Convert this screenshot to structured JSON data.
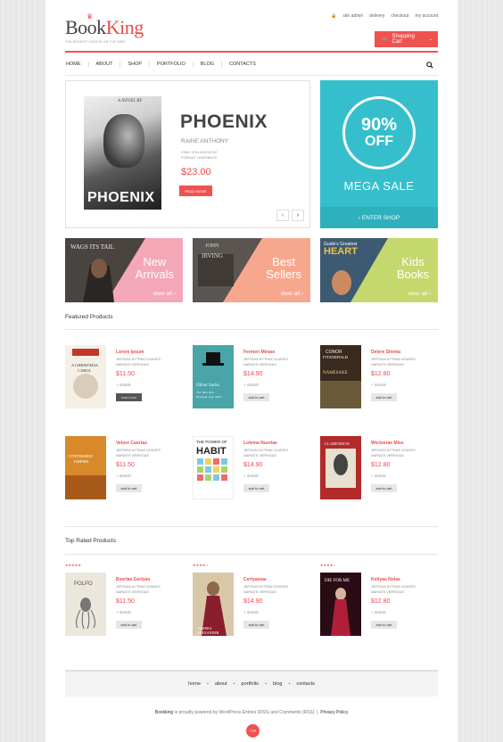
{
  "header": {
    "logo_part1": "Book",
    "logo_part2": "King",
    "tagline": "THE BIGGEST CHOICE ON THE WEB",
    "top_links": [
      "site admin",
      "delivery",
      "checkout",
      "my account"
    ],
    "cart_label": "Shopping Cart",
    "nav": [
      "HOME",
      "ABOUT",
      "SHOP",
      "PORTFOLIO",
      "BLOG",
      "CONTACTS"
    ]
  },
  "hero": {
    "cover_top": "A NOVEL BY",
    "cover_title": "PHOENIX",
    "title": "PHOENIX",
    "author": "RAINE ANTHONY",
    "isbn": "ISBN: 9781409916780",
    "format": "FORMAT: HARDBACK",
    "price": "$23.00",
    "button": "READ MORE",
    "prev": "‹",
    "next": "›"
  },
  "mega_sale": {
    "percent": "90%",
    "off": "OFF",
    "label": "MEGA SALE",
    "enter": "ENTER SHOP"
  },
  "banners": [
    {
      "line1": "New",
      "line2": "Arrivals",
      "view": "view all",
      "color": "#f4a7b7"
    },
    {
      "line1": "Best",
      "line2": "Sellers",
      "view": "view all",
      "color": "#f8a78f"
    },
    {
      "line1": "Kids",
      "line2": "Books",
      "view": "view all",
      "color": "#c5d86d"
    }
  ],
  "featured": {
    "title": "Featured Products",
    "items": [
      {
        "name": "Lorem Ipsum",
        "desc": "JERTASA NYTRAE DOASES NARIATS VERRIGAS",
        "price": "$11.50",
        "details": "+ details",
        "cart": "read more"
      },
      {
        "name": "Fermen Mirase",
        "desc": "JERTASA NYTRAE DOASES NARIATS VERRIGAS",
        "price": "$14.90",
        "details": "+ details",
        "cart": "add to cart"
      },
      {
        "name": "Delere Sitema",
        "desc": "JERTASA NYTRAE DOASES NARIATS VERRIGAS",
        "price": "$12.80",
        "details": "+ details",
        "cart": "add to cart"
      },
      {
        "name": "Velore Caortas",
        "desc": "JERTASA NYTRAE DOASES NARIATS VERRIGAS",
        "price": "$11.50",
        "details": "+ details",
        "cart": "add to cart"
      },
      {
        "name": "Lotema Nusrtas",
        "desc": "JERTASA NYTRAE DOASES NARIATS VERRIGAS",
        "price": "$14.90",
        "details": "+ details",
        "cart": "add to cart"
      },
      {
        "name": "Wertserae Mise",
        "desc": "JERTASA NYTRAE DOASES NARIATS VERRIGAS",
        "price": "$12.80",
        "details": "+ details",
        "cart": "add to cart"
      }
    ]
  },
  "top_rated": {
    "title": "Top Rated Products",
    "items": [
      {
        "stars": "★★★★★",
        "name": "Bsertas Gertyas",
        "desc": "JERTASA NYTRAE DOASES NARIATS VERRIGAS",
        "price": "$11.50",
        "details": "+ details",
        "cart": "add to cart"
      },
      {
        "stars": "★★★★☆",
        "name": "Certyaesar",
        "desc": "JERTASA NYTRAE DOASES NARIATS VERRIGAS",
        "price": "$14.90",
        "details": "+ details",
        "cart": "add to cart"
      },
      {
        "stars": "★★★★☆",
        "name": "Keityas Nolas",
        "desc": "JERTASA NYTRAE DOASES NARIATS VERRIGAS",
        "price": "$12.80",
        "details": "+ details",
        "cart": "add to cart"
      }
    ]
  },
  "covers": {
    "oliver": "Oliver Sacks",
    "oliver_sub": "The Man Who Mistook His Wife for a Hat",
    "namesake_author": "CONOR FITZGERALD",
    "namesake_title": "THE NAMESAKE",
    "habit_top": "THE POWER OF",
    "habit_main": "HABIT",
    "clarendon": "CLARENDON",
    "polpo": "POLPO",
    "tamera": "TAMERA ALEXANDER",
    "die_for_me": "DIE FOR ME",
    "christmas": "A CHRISTMAS CAROL",
    "empire": "UNFINISHED EMPIRE"
  },
  "footer": {
    "links": [
      "home",
      "about",
      "portfolio",
      "blog",
      "contacts"
    ],
    "brand": "Bookking",
    "powered": " is proudly powered by WordPress Entries (RSS) and Comments (RSS)  |  ",
    "privacy": "Privacy Policy",
    "top": "TOP"
  },
  "colors": {
    "accent": "#ef5350",
    "teal": "#35bfcd"
  }
}
